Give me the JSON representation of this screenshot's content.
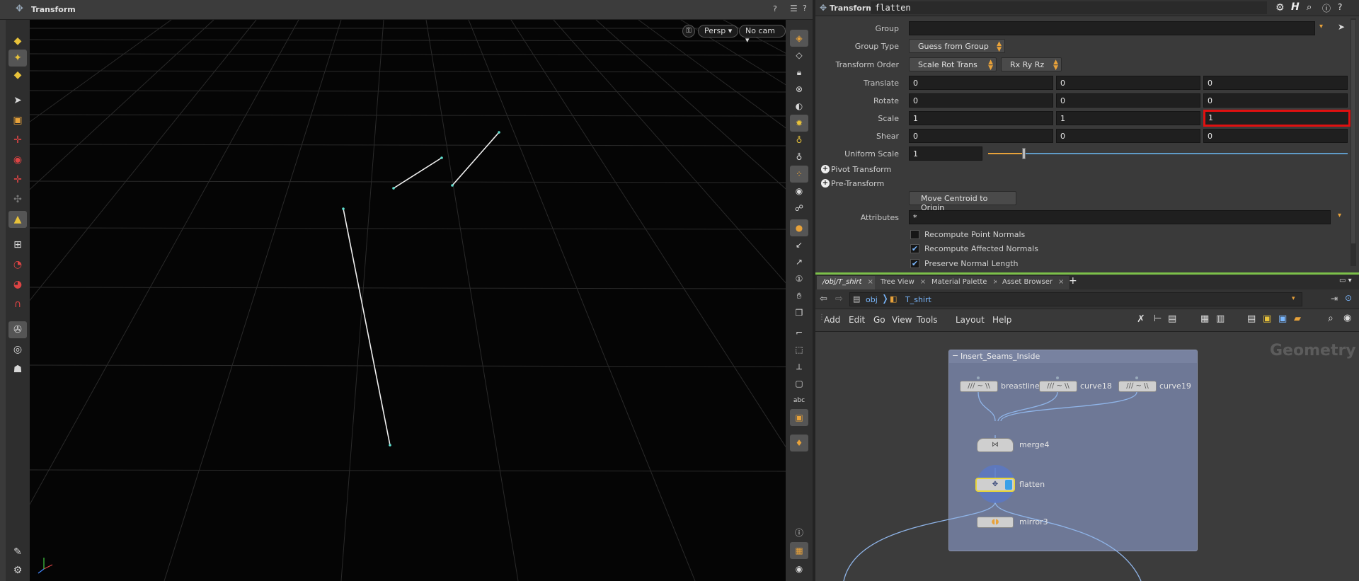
{
  "viewport": {
    "title": "Transform",
    "persp_label": "Persp",
    "cam_label": "No cam"
  },
  "params": {
    "node_type": "Transform",
    "node_name": "flatten",
    "group": {
      "label": "Group",
      "value": ""
    },
    "group_type": {
      "label": "Group Type",
      "value": "Guess from Group"
    },
    "transform_order": {
      "label": "Transform Order",
      "value": "Scale Rot Trans",
      "rot_value": "Rx Ry Rz"
    },
    "translate": {
      "label": "Translate",
      "x": "0",
      "y": "0",
      "z": "0"
    },
    "rotate": {
      "label": "Rotate",
      "x": "0",
      "y": "0",
      "z": "0"
    },
    "scale": {
      "label": "Scale",
      "x": "1",
      "y": "1",
      "z": "1"
    },
    "shear": {
      "label": "Shear",
      "x": "0",
      "y": "0",
      "z": "0"
    },
    "uniform_scale": {
      "label": "Uniform Scale",
      "value": "1",
      "slider_fraction": 0.1
    },
    "pivot_transform": "Pivot Transform",
    "pre_transform": "Pre-Transform",
    "move_centroid": "Move Centroid to Origin",
    "attributes": {
      "label": "Attributes",
      "value": "*"
    },
    "recompute_point_normals": {
      "label": "Recompute Point Normals",
      "checked": false
    },
    "recompute_affected_normals": {
      "label": "Recompute Affected Normals",
      "checked": true
    },
    "preserve_normal_length": {
      "label": "Preserve Normal Length",
      "checked": true
    }
  },
  "tabs": [
    {
      "label": "/obj/T_shirt"
    },
    {
      "label": "Tree View"
    },
    {
      "label": "Material Palette"
    },
    {
      "label": "Asset Browser"
    }
  ],
  "path": {
    "root": "obj",
    "child": "T_shirt"
  },
  "net_menu": [
    "Add",
    "Edit",
    "Go",
    "View",
    "Tools",
    "Layout",
    "Help"
  ],
  "network": {
    "context_label": "Geometry",
    "subnet_title": "Insert_Seams_Inside",
    "nodes": {
      "breastline": "breastline",
      "curve18": "curve18",
      "curve19": "curve19",
      "merge4": "merge4",
      "flatten": "flatten",
      "mirror3": "mirror3"
    }
  },
  "colors": {
    "accent_green": "#7cc04a",
    "selection_yellow": "#e8d53a",
    "highlight_red": "#e01010",
    "subnet_bg": "#6e7896",
    "link_blue": "#8fb4e8"
  }
}
